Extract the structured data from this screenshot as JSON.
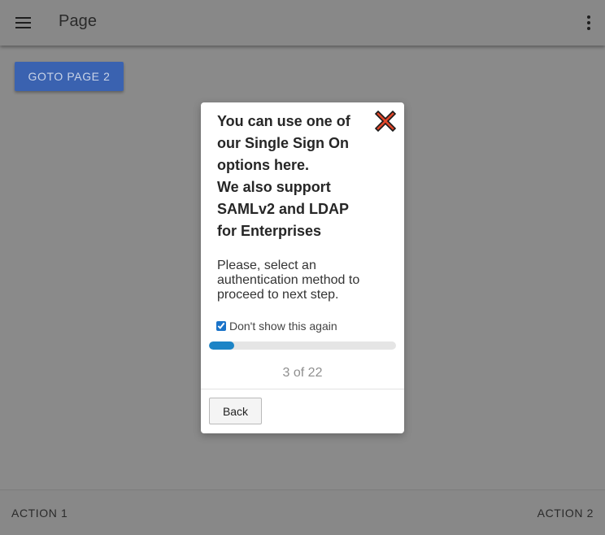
{
  "app_bar": {
    "title": "Page",
    "menu_icon": "hamburger-menu-icon",
    "more_icon": "more-vertical-icon"
  },
  "main": {
    "goto_button_label": "GOTO PAGE 2"
  },
  "tour": {
    "title_lines": [
      "You can use one of",
      "our Single Sign On",
      "options here.",
      "We also support",
      "SAMLv2 and LDAP",
      "for Enterprises"
    ],
    "body_lines": [
      "Please, select an",
      "authentication method to",
      "proceed to next step."
    ],
    "dont_show_label": "Don't show this again",
    "dont_show_checked": true,
    "step_current": 3,
    "step_total": 22,
    "step_text": "3 of 22",
    "back_label": "Back",
    "close_icon": "close-x-icon",
    "colors": {
      "close_fill": "#e0472b",
      "progress": "#1c84c6"
    }
  },
  "bottom_bar": {
    "action1_label": "ACTION 1",
    "action2_label": "ACTION 2"
  },
  "colors": {
    "overlay_background": "#8a8a8a",
    "primary_button": "#3a62b0"
  }
}
